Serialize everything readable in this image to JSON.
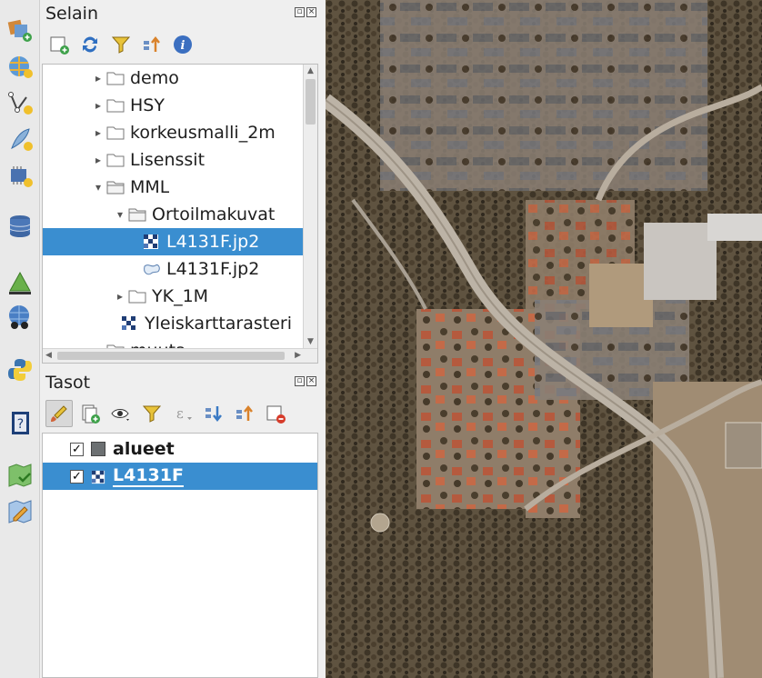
{
  "browser": {
    "title": "Selain",
    "tree": [
      {
        "label": "demo",
        "icon": "folder-icon",
        "arrow": "▸"
      },
      {
        "label": "HSY",
        "icon": "folder-icon",
        "arrow": "▸"
      },
      {
        "label": "korkeusmalli_2m",
        "icon": "folder-icon",
        "arrow": "▸"
      },
      {
        "label": "Lisenssit",
        "icon": "folder-icon",
        "arrow": "▸"
      },
      {
        "label": "MML",
        "icon": "folder-open-icon",
        "arrow": "▾"
      },
      {
        "label": "Ortoilmakuvat",
        "icon": "folder-open-icon",
        "arrow": "▾"
      },
      {
        "label": "L4131F.jp2",
        "icon": "raster-icon",
        "arrow": ""
      },
      {
        "label": "L4131F.jp2",
        "icon": "vector-layer-icon",
        "arrow": ""
      },
      {
        "label": "YK_1M",
        "icon": "folder-icon",
        "arrow": "▸"
      },
      {
        "label": "Yleiskarttarasteri",
        "icon": "raster-icon",
        "arrow": ""
      },
      {
        "label": "muuta",
        "icon": "folder-icon",
        "arrow": "▸"
      }
    ]
  },
  "layers": {
    "title": "Tasot",
    "items": [
      {
        "label": "alueet",
        "checked": "✓"
      },
      {
        "label": "L4131F",
        "checked": "✓"
      }
    ]
  },
  "colors": {
    "selection": "#3a8ed0",
    "panel_bg": "#efefef"
  }
}
